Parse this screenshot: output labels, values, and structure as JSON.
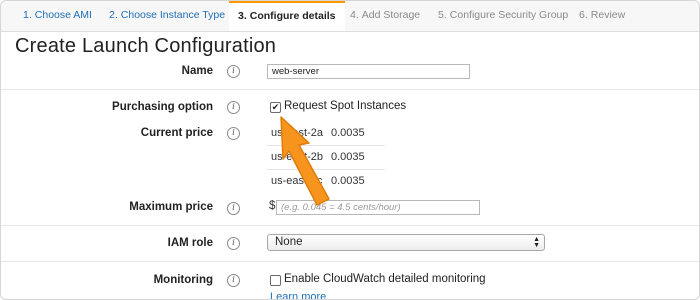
{
  "wizard": {
    "steps": [
      {
        "num": "1.",
        "label": "Choose AMI"
      },
      {
        "num": "2.",
        "label": "Choose Instance Type"
      },
      {
        "num": "3.",
        "label": "Configure details"
      },
      {
        "num": "4.",
        "label": "Add Storage"
      },
      {
        "num": "5.",
        "label": "Configure Security Group"
      },
      {
        "num": "6.",
        "label": "Review"
      }
    ],
    "active_step": 3
  },
  "page": {
    "title": "Create Launch Configuration"
  },
  "form": {
    "name": {
      "label": "Name",
      "value": "web-server"
    },
    "purchasing": {
      "label": "Purchasing option",
      "checkbox_label": "Request Spot Instances",
      "checked": true,
      "check_mark": "✔"
    },
    "current_price": {
      "label": "Current price",
      "rows": [
        {
          "zone": "us-east-2a",
          "price": "0.0035"
        },
        {
          "zone": "us-east-2b",
          "price": "0.0035"
        },
        {
          "zone": "us-east-2c",
          "price": "0.0035"
        }
      ]
    },
    "maximum_price": {
      "label": "Maximum price",
      "currency": "$",
      "placeholder": "(e.g. 0.045 = 4.5 cents/hour)"
    },
    "iam_role": {
      "label": "IAM role",
      "selected": "None"
    },
    "monitoring": {
      "label": "Monitoring",
      "checkbox_label": "Enable CloudWatch detailed monitoring",
      "link": "Learn more"
    }
  },
  "info_icon_glyph": "i",
  "colors": {
    "accent_orange": "#f7941d",
    "link_blue": "#1e6fb8",
    "active_tab_border": "#ff9900"
  }
}
